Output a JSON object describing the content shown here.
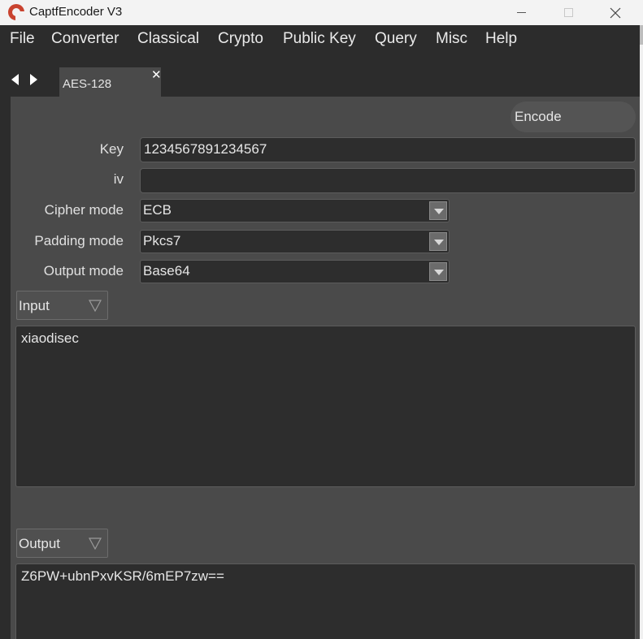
{
  "window": {
    "title": "CaptfEncoder V3"
  },
  "menu": {
    "items": [
      "File",
      "Converter",
      "Classical",
      "Crypto",
      "Public Key",
      "Query",
      "Misc",
      "Help"
    ]
  },
  "tabs": [
    {
      "label": "AES-128"
    }
  ],
  "form": {
    "encode_label": "Encode",
    "key_label": "Key",
    "key_value": "1234567891234567",
    "iv_label": "iv",
    "iv_value": "",
    "cipher_label": "Cipher mode",
    "cipher_value": "ECB",
    "padding_label": "Padding mode",
    "padding_value": "Pkcs7",
    "output_mode_label": "Output mode",
    "output_mode_value": "Base64"
  },
  "input": {
    "selector_label": "Input",
    "text": "xiaodisec"
  },
  "output": {
    "selector_label": "Output",
    "text": "Z6PW+ubnPxvKSR/6mEP7zw=="
  },
  "colors": {
    "app_icon": "#c9432f",
    "background": "#4a4a4a",
    "menubar": "#2c2c2c"
  }
}
